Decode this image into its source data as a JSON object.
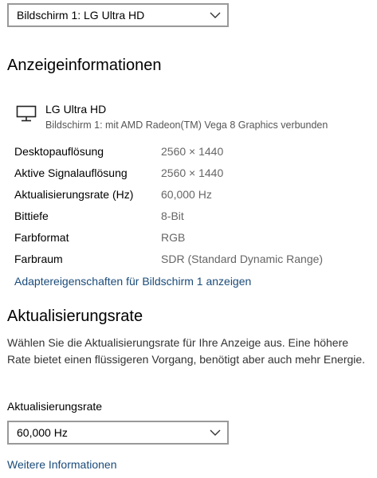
{
  "display_selector": {
    "selected": "Bildschirm 1: LG Ultra HD",
    "icon": "chevron-down-icon"
  },
  "display_info": {
    "heading": "Anzeigeinformationen",
    "monitor_icon": "monitor-icon",
    "display_name": "LG Ultra HD",
    "display_subtitle": "Bildschirm 1: mit AMD Radeon(TM) Vega 8 Graphics verbunden",
    "rows": [
      {
        "label": "Desktopauflösung",
        "value": "2560 × 1440"
      },
      {
        "label": "Aktive Signalauflösung",
        "value": "2560 × 1440"
      },
      {
        "label": "Aktualisierungsrate (Hz)",
        "value": "60,000 Hz"
      },
      {
        "label": "Bittiefe",
        "value": "8-Bit"
      },
      {
        "label": "Farbformat",
        "value": "RGB"
      },
      {
        "label": "Farbraum",
        "value": "SDR (Standard Dynamic Range)"
      }
    ],
    "adapter_link": "Adaptereigenschaften für Bildschirm 1 anzeigen"
  },
  "refresh_rate": {
    "heading": "Aktualisierungsrate",
    "description": "Wählen Sie die Aktualisierungsrate für Ihre Anzeige aus. Eine höhere Rate bietet einen flüssigeren Vorgang, benötigt aber auch mehr Energie.",
    "field_label": "Aktualisierungsrate",
    "selected": "60,000 Hz",
    "more_info_link": "Weitere Informationen"
  },
  "colors": {
    "link": "#1a4b7a",
    "border": "#999999",
    "secondary_text": "#666666"
  }
}
